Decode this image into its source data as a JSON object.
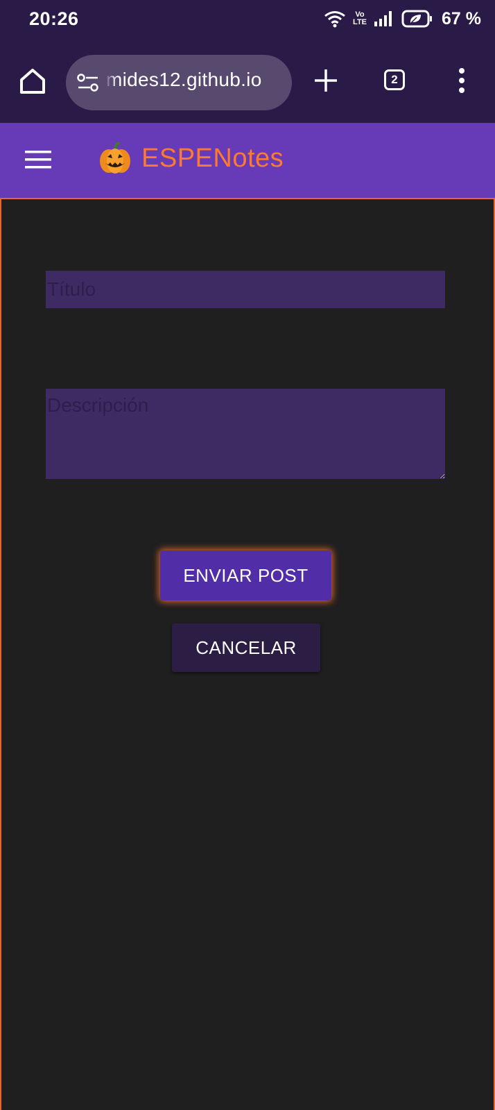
{
  "status_bar": {
    "time": "20:26",
    "network": "VoLTE",
    "volte_top": "Vo",
    "volte_bottom": "LTE",
    "battery": "67 %"
  },
  "browser": {
    "url": "mides12.github.io",
    "tab_count": "2"
  },
  "app": {
    "title": "ESPENotes",
    "logo_icon": "pumpkin-icon",
    "accent_color": "#ff7a2e",
    "header_color": "#673ab7"
  },
  "form": {
    "title_placeholder": "Título",
    "description_placeholder": "Descripción",
    "submit_label": "ENVIAR POST",
    "cancel_label": "CANCELAR"
  }
}
